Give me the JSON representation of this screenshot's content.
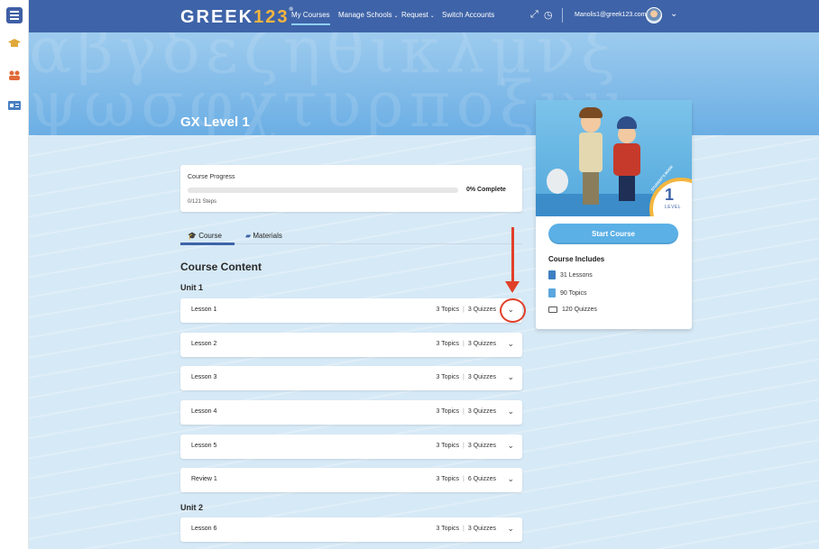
{
  "brand": {
    "logo_main": "GREEK",
    "logo_num": "123",
    "logo_tm": "®"
  },
  "nav": {
    "items": [
      {
        "label": "My Courses",
        "active": true
      },
      {
        "label": "Manage Schools",
        "caret": true
      },
      {
        "label": "Request",
        "caret": true
      },
      {
        "label": "Switch Accounts"
      }
    ],
    "user_email": "Manolis1@greek123.com"
  },
  "icons": {
    "rail": [
      "menu-icon",
      "graduation-cap-icon",
      "users-icon",
      "id-card-icon"
    ],
    "top": [
      "expand-icon",
      "clock-icon",
      "chevron-down-icon"
    ]
  },
  "course": {
    "title": "GX Level 1",
    "progress_label": "Course Progress",
    "progress_percent": 0,
    "progress_text": "0% Complete",
    "steps_text": "0/121 Steps"
  },
  "tabs": [
    {
      "label": "Course",
      "icon": "graduation-cap-icon",
      "active": true
    },
    {
      "label": "Materials",
      "icon": "folder-icon",
      "active": false
    }
  ],
  "content": {
    "heading": "Course Content",
    "units": [
      {
        "title": "Unit 1",
        "lessons": [
          {
            "name": "Lesson 1",
            "topics": "3 Topics",
            "quizzes": "3 Quizzes"
          },
          {
            "name": "Lesson 2",
            "topics": "3 Topics",
            "quizzes": "3 Quizzes"
          },
          {
            "name": "Lesson 3",
            "topics": "3 Topics",
            "quizzes": "3 Quizzes"
          },
          {
            "name": "Lesson 4",
            "topics": "3 Topics",
            "quizzes": "3 Quizzes"
          },
          {
            "name": "Lesson 5",
            "topics": "3 Topics",
            "quizzes": "3 Quizzes"
          },
          {
            "name": "Review 1",
            "topics": "3 Topics",
            "quizzes": "6 Quizzes"
          }
        ]
      },
      {
        "title": "Unit 2",
        "lessons": [
          {
            "name": "Lesson 6",
            "topics": "3 Topics",
            "quizzes": "3 Quizzes"
          }
        ]
      }
    ]
  },
  "sidebar": {
    "cover_level": "1",
    "cover_level_label": "LEVEL",
    "cover_tag": "STUDENT'S BOOK",
    "start_button": "Start Course",
    "includes_title": "Course Includes",
    "includes": [
      {
        "icon": "book-icon",
        "text": "31 Lessons"
      },
      {
        "icon": "document-icon",
        "text": "90 Topics"
      },
      {
        "icon": "laptop-icon",
        "text": "120 Quizzes"
      }
    ]
  },
  "colors": {
    "nav_bg": "#3e63a8",
    "accent_orange": "#f4b63f",
    "button_blue": "#5bb0e6",
    "annotation_red": "#e0402a"
  }
}
